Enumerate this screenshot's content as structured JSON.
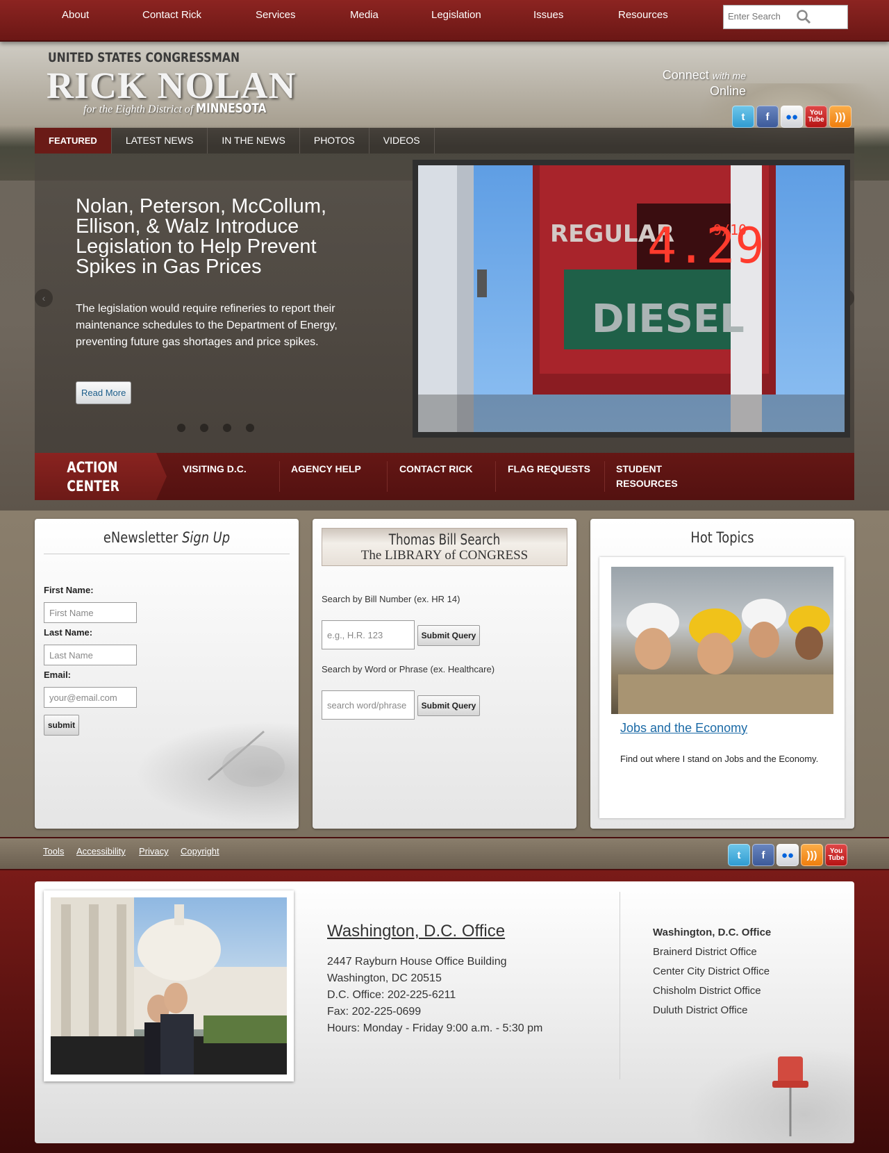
{
  "topnav": {
    "items": [
      "About",
      "Contact Rick",
      "Services",
      "Media",
      "Legislation",
      "Issues",
      "Resources"
    ],
    "search_placeholder": "Enter Search"
  },
  "branding": {
    "line1": "UNITED STATES CONGRESSMAN",
    "name": "RICK NOLAN",
    "line3": "for the Eighth District of",
    "state": "MINNESOTA"
  },
  "connect": {
    "word1": "Connect",
    "word2": "with me",
    "word3": "Online",
    "icons": [
      "twitter-icon",
      "facebook-icon",
      "flickr-icon",
      "youtube-icon",
      "rss-icon"
    ]
  },
  "tabs": [
    "FEATURED",
    "LATEST NEWS",
    "IN THE NEWS",
    "PHOTOS",
    "VIDEOS"
  ],
  "slide": {
    "title": "Nolan, Peterson, McCollum, Ellison, & Walz Introduce Legislation to Help Prevent Spikes in Gas Prices",
    "text": "The legislation would require refineries to report their maintenance schedules to the Department of Energy, preventing future gas shortages and price spikes.",
    "read_more": "Read More",
    "sign_regular": "REGULAR",
    "sign_price": "4.29",
    "sign_tenths": "9/10",
    "sign_diesel": "DIESEL"
  },
  "action_center": {
    "label_line1": "ACTION",
    "label_line2": "CENTER",
    "links": [
      "VISITING D.C.",
      "AGENCY HELP",
      "CONTACT RICK",
      "FLAG REQUESTS",
      "STUDENT RESOURCES"
    ]
  },
  "newsletter": {
    "title_a": "eNewsletter",
    "title_b": "Sign Up",
    "first_label": "First Name:",
    "first_placeholder": "First Name",
    "last_label": "Last Name:",
    "last_placeholder": "Last Name",
    "email_label": "Email:",
    "email_placeholder": "your@email.com",
    "submit": "submit"
  },
  "thomas": {
    "banner_line1": "Thomas Bill Search",
    "banner_line2": "The LIBRARY of CONGRESS",
    "bill_label": "Search by Bill Number (ex. HR 14)",
    "bill_placeholder": "e.g., H.R. 123",
    "word_label": "Search by Word or Phrase (ex. Healthcare)",
    "word_placeholder": "search word/phrase",
    "submit": "Submit Query"
  },
  "hot_topics": {
    "title": "Hot Topics",
    "link": "Jobs and the Economy",
    "text": "Find out where I stand on Jobs and the Economy."
  },
  "footer_links": [
    "Tools",
    "Accessibility",
    "Privacy",
    "Copyright"
  ],
  "footer_icons": [
    "twitter-icon",
    "facebook-icon",
    "flickr-icon",
    "rss-icon",
    "youtube-icon"
  ],
  "office": {
    "title": "Washington, D.C. Office",
    "lines": [
      "2447 Rayburn House Office Building",
      "Washington, DC 20515",
      "D.C. Office: 202-225-6211",
      "Fax: 202-225-0699",
      "Hours: Monday - Friday 9:00 a.m. - 5:30 pm"
    ],
    "list": [
      "Washington, D.C. Office",
      "Brainerd District Office",
      "Center City District Office",
      "Chisholm District Office",
      "Duluth District Office"
    ]
  },
  "colors": {
    "maroon": "#6b1715",
    "link_blue": "#1b6aa6"
  }
}
